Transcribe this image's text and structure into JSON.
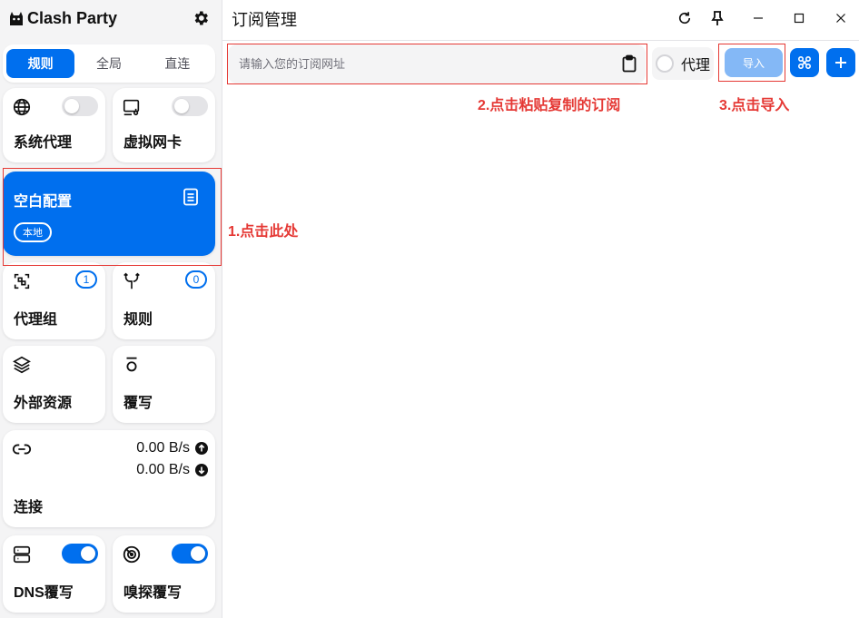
{
  "app": {
    "name": "Clash Party"
  },
  "mode_tabs": [
    {
      "label": "规则",
      "active": true
    },
    {
      "label": "全局",
      "active": false
    },
    {
      "label": "直连",
      "active": false
    }
  ],
  "cards": {
    "system_proxy": {
      "title": "系统代理",
      "icon": "globe-icon",
      "enabled": false
    },
    "tun": {
      "title": "虚拟网卡",
      "icon": "virtual-nic-icon",
      "enabled": false
    },
    "profile": {
      "title": "空白配置",
      "icon": "document-icon",
      "chip": "本地"
    },
    "proxy_groups": {
      "title": "代理组",
      "icon": "proxy-group-icon",
      "count": "1"
    },
    "rules": {
      "title": "规则",
      "icon": "fork-icon",
      "count": "0"
    },
    "resources": {
      "title": "外部资源",
      "icon": "layers-icon"
    },
    "override": {
      "title": "覆写",
      "icon": "override-icon"
    },
    "connections": {
      "title": "连接",
      "icon": "link-icon",
      "upload": "0.00 B/s",
      "download": "0.00 B/s"
    },
    "dns": {
      "title": "DNS覆写",
      "icon": "server-icon",
      "enabled": true
    },
    "sniff": {
      "title": "嗅探覆写",
      "icon": "radar-icon",
      "enabled": true
    }
  },
  "main": {
    "title": "订阅管理",
    "input_placeholder": "请输入您的订阅网址",
    "input_value": "",
    "proxy_label": "代理",
    "proxy_checked": false,
    "import_label": "导入"
  },
  "annotations": [
    "1.点击此处",
    "2.点击粘贴复制的订阅",
    "3.点击导入"
  ],
  "colors": {
    "accent": "#006fee",
    "import_disabled": "#84b8f6",
    "annotation": "#e53935",
    "sidebar_bg": "#f4f4f5"
  }
}
